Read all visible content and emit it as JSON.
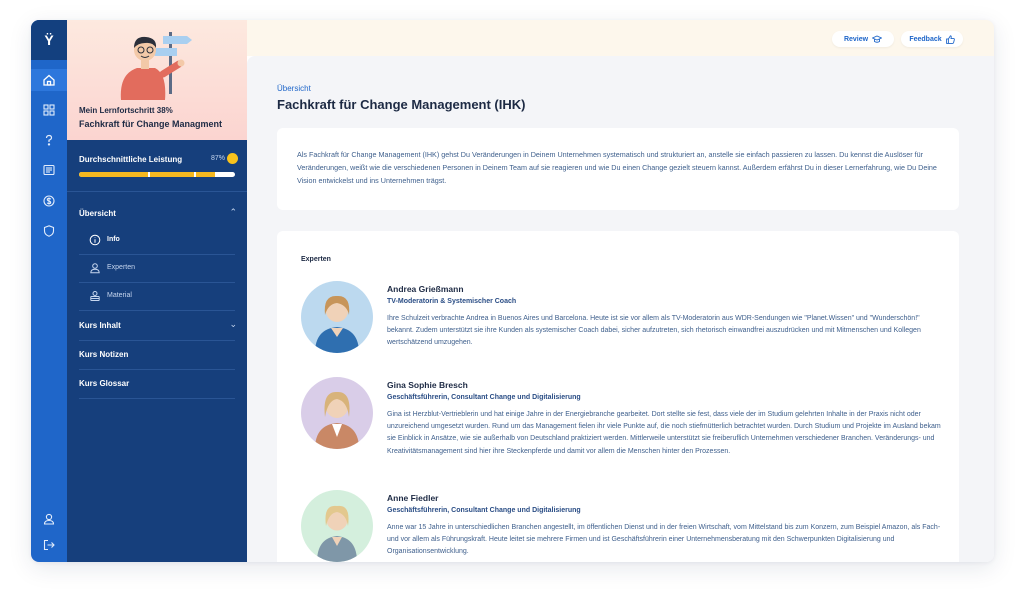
{
  "rail": {
    "logo": "Ÿ",
    "icons": [
      "home-icon",
      "grid-icon",
      "question-icon",
      "notes-icon",
      "dollar-icon",
      "shield-icon",
      "user-icon",
      "logout-icon"
    ]
  },
  "sidebar": {
    "progress_label": "Mein Lernfortschritt 38%",
    "course_title": "Fachkraft für Change Managment",
    "performance_label": "Durchschnittliche Leistung",
    "performance_value": "87%",
    "performance_fraction": 0.87,
    "sections": {
      "overview": "Übersicht",
      "course_content": "Kurs Inhalt",
      "course_notes": "Kurs Notizen",
      "course_glossary": "Kurs Glossar"
    },
    "sub_items": {
      "info": "Info",
      "experts": "Experten",
      "material": "Material"
    }
  },
  "topbar": {
    "review": "Review",
    "feedback": "Feedback"
  },
  "main": {
    "breadcrumb": "Übersicht",
    "title": "Fachkraft für Change Management (IHK)",
    "intro": "Als Fachkraft für Change Management (IHK) gehst Du Veränderungen in Deinem Unternehmen systematisch und strukturiert an, anstelle sie einfach passieren zu lassen. Du kennst die Auslöser für Veränderungen, weißt wie die verschiedenen Personen in Deinem Team auf sie reagieren und wie Du einen Change gezielt steuern kannst. Außerdem erfährst Du in dieser Lernerfahrung, wie Du Deine Vision entwickelst und ins Unternehmen trägst.",
    "experts_heading": "Experten",
    "experts": [
      {
        "name": "Andrea Grießmann",
        "role": "TV-Moderatorin & Systemischer Coach",
        "bio": "Ihre Schulzeit verbrachte Andrea in Buenos Aires und Barcelona. Heute ist sie vor allem als TV-Moderatorin aus WDR-Sendungen wie \"Planet.Wissen\" und \"Wunderschön!\" bekannt. Zudem unterstützt sie ihre Kunden als systemischer Coach dabei, sicher aufzutreten, sich rhetorisch einwandfrei auszudrücken und mit Mitmenschen und Kollegen wertschätzend umzugehen."
      },
      {
        "name": "Gina Sophie Bresch",
        "role": "Geschäftsführerin, Consultant Change und Digitalisierung",
        "bio": "Gina ist Herzblut-Vertrieblerin und hat einige Jahre in der Energiebranche gearbeitet. Dort stellte sie fest, dass viele der im Studium gelehrten Inhalte in der Praxis nicht oder unzureichend umgesetzt wurden. Rund um das Management fielen ihr viele Punkte auf, die noch stiefmütterlich betrachtet wurden. Durch Studium und Projekte im Ausland bekam sie Einblick in Ansätze, wie sie außerhalb von Deutschland praktiziert werden. Mittlerweile unterstützt sie freiberuflich Unternehmen verschiedener Branchen. Veränderungs- und Kreativitätsmanagement sind hier ihre Steckenpferde und damit vor allem die Menschen hinter den Prozessen."
      },
      {
        "name": "Anne Fiedler",
        "role": "Geschäftsführerin, Consultant Change und Digitalisierung",
        "bio": "Anne war 15 Jahre in unterschiedlichen Branchen angestellt, im öffentlichen Dienst und in der freien Wirtschaft, vom Mittelstand bis zum Konzern, zum Beispiel Amazon, als Fach- und vor allem als Führungskraft. Heute leitet sie mehrere Firmen und ist Geschäftsführerin einer Unternehmensberatung mit den Schwerpunkten Digitalisierung und Organisationsentwicklung."
      }
    ]
  },
  "colors": {
    "rail": "#1f66c9",
    "sidebar": "#163f7c",
    "accent": "#f5b820",
    "text_dark": "#1d2a44",
    "text_body": "#3e5f8c"
  }
}
